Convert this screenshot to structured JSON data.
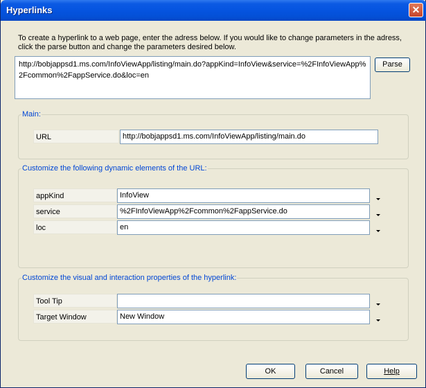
{
  "window": {
    "title": "Hyperlinks",
    "close_glyph": "✕"
  },
  "intro_text": "To create a hyperlink to a web page, enter the adress below. If you would like to change parameters in the adress, click the parse button and change the parameters desired below.",
  "url_input": "http://bobjappsd1.ms.com/InfoViewApp/listing/main.do?appKind=InfoView&service=%2FInfoViewApp%2Fcommon%2FappService.do&loc=en",
  "parse_label": "Parse",
  "main_group": {
    "label": "Main:",
    "url_label": "URL",
    "url_value": "http://bobjappsd1.ms.com/InfoViewApp/listing/main.do"
  },
  "dynamic_group": {
    "label": "Customize the following dynamic elements of the URL:",
    "rows": [
      {
        "label": "appKind",
        "value": "InfoView"
      },
      {
        "label": "service",
        "value": "%2FInfoViewApp%2Fcommon%2FappService.do"
      },
      {
        "label": "loc",
        "value": "en"
      }
    ]
  },
  "visual_group": {
    "label": "Customize the visual and interaction properties of the hyperlink:",
    "rows": [
      {
        "label": "Tool Tip",
        "value": ""
      },
      {
        "label": "Target Window",
        "value": "New Window"
      }
    ]
  },
  "buttons": {
    "ok": "OK",
    "cancel": "Cancel",
    "help": "Help"
  },
  "icons": {
    "dropdown": "chevron-down-icon",
    "close": "close-icon"
  }
}
